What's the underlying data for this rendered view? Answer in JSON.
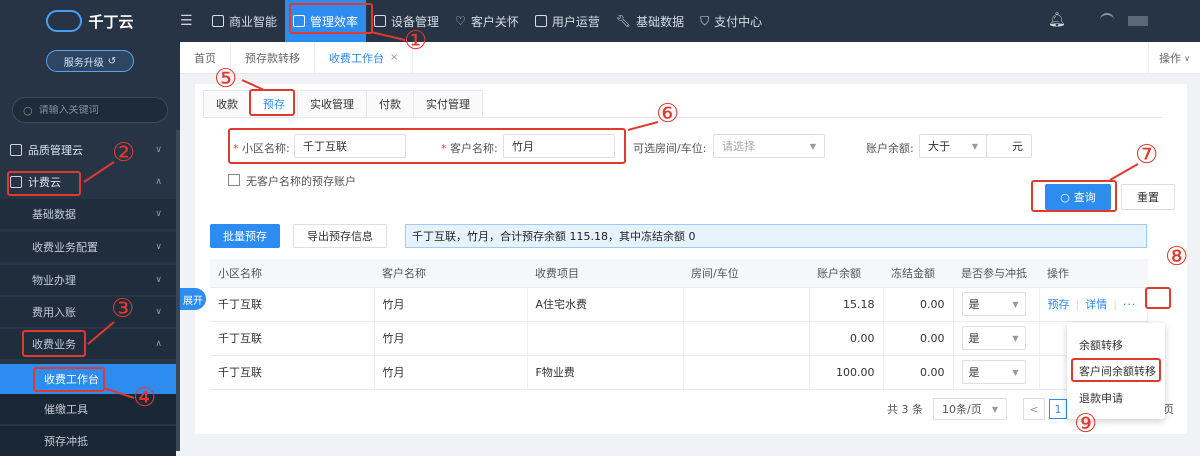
{
  "app": {
    "name": "千丁云",
    "upgrade_label": "服务升级"
  },
  "sidebar": {
    "search_placeholder": "请输入关键词",
    "items": [
      {
        "label": "品质管理云",
        "level": 1,
        "expanded": false
      },
      {
        "label": "计费云",
        "level": 1,
        "expanded": true
      },
      {
        "label": "基础数据",
        "level": 2,
        "expanded": false
      },
      {
        "label": "收费业务配置",
        "level": 2,
        "expanded": false
      },
      {
        "label": "物业办理",
        "level": 2,
        "expanded": false
      },
      {
        "label": "费用入账",
        "level": 2,
        "expanded": false
      },
      {
        "label": "收费业务",
        "level": 2,
        "expanded": true
      },
      {
        "label": "收费工作台",
        "level": 3,
        "active": true
      },
      {
        "label": "催缴工具",
        "level": 3
      },
      {
        "label": "预存冲抵",
        "level": 3
      }
    ]
  },
  "topnav": {
    "tabs": [
      {
        "label": "商业智能",
        "icon": "chart-icon"
      },
      {
        "label": "管理效率",
        "icon": "trend-icon",
        "active": true
      },
      {
        "label": "设备管理",
        "icon": "device-icon"
      },
      {
        "label": "客户关怀",
        "icon": "heart-icon"
      },
      {
        "label": "用户运营",
        "icon": "user-icon"
      },
      {
        "label": "基础数据",
        "icon": "wrench-icon"
      },
      {
        "label": "支付中心",
        "icon": "shield-icon"
      }
    ]
  },
  "page_tabs": [
    {
      "label": "首页"
    },
    {
      "label": "预存款转移"
    },
    {
      "label": "收费工作台",
      "current": true,
      "closable": true
    }
  ],
  "page_tabs_ops": "操作",
  "sub_tabs": [
    {
      "label": "收款"
    },
    {
      "label": "预存",
      "current": true
    },
    {
      "label": "实收管理"
    },
    {
      "label": "付款"
    },
    {
      "label": "实付管理"
    }
  ],
  "filters": {
    "community_label": "小区名称:",
    "community_value": "千丁互联",
    "customer_label": "客户名称:",
    "customer_value": "竹月",
    "room_label": "可选房间/车位:",
    "room_placeholder": "请选择",
    "balance_label": "账户余额:",
    "balance_op": "大于",
    "balance_unit": "元",
    "no_customer_label": "无客户名称的预存账户",
    "query_label": "查询",
    "reset_label": "重置"
  },
  "actions": {
    "batch_prepay": "批量预存",
    "export": "导出预存信息",
    "summary": "千丁互联，竹月，合计预存余额 115.18，其中冻结余额 0"
  },
  "table": {
    "headers": [
      "小区名称",
      "客户名称",
      "收费项目",
      "房间/车位",
      "账户余额",
      "冻结金额",
      "是否参与冲抵",
      "操作"
    ],
    "rows": [
      {
        "community": "千丁互联",
        "customer": "竹月",
        "item": "A住宅水费",
        "room": "",
        "balance": "15.18",
        "frozen": "0.00",
        "offset": "是",
        "ops": [
          "预存",
          "详情"
        ]
      },
      {
        "community": "千丁互联",
        "customer": "竹月",
        "item": "",
        "room": "",
        "balance": "0.00",
        "frozen": "0.00",
        "offset": "是",
        "ops": []
      },
      {
        "community": "千丁互联",
        "customer": "竹月",
        "item": "F物业费",
        "room": "",
        "balance": "100.00",
        "frozen": "0.00",
        "offset": "是",
        "ops": []
      }
    ],
    "more_label": "···"
  },
  "expand_label": "展开",
  "pagination": {
    "total": "共 3 条",
    "page_size": "10条/页",
    "current_page": "1",
    "suffix": "页"
  },
  "popup_menu": [
    "余额转移",
    "客户间余额转移",
    "退款申请"
  ],
  "annotations": [
    "①",
    "②",
    "③",
    "④",
    "⑤",
    "⑥",
    "⑦",
    "⑧",
    "⑨"
  ],
  "colors": {
    "primary": "#2d8cf0",
    "sidebar": "#263445",
    "annotation": "#e03a2e"
  }
}
